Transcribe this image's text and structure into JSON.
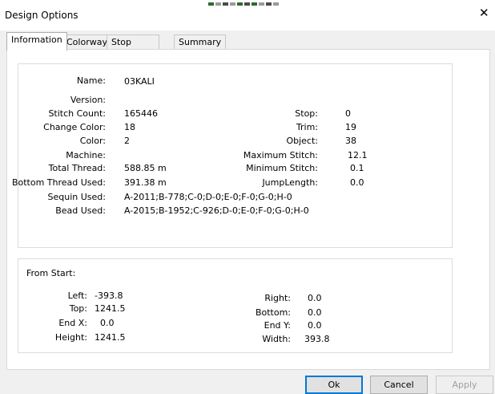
{
  "window": {
    "title": "Design Options",
    "close_glyph": "✕"
  },
  "tabs": [
    "Information",
    "Colorway",
    "Stop Sequence",
    "Summary"
  ],
  "info": {
    "name": {
      "label": "Name:",
      "value": "03KALI"
    },
    "version": {
      "label": "Version:",
      "value": ""
    },
    "stitch_count": {
      "label": "Stitch Count:",
      "value": "165446"
    },
    "change_color": {
      "label": "Change Color:",
      "value": "18"
    },
    "color": {
      "label": "Color:",
      "value": "2"
    },
    "machine": {
      "label": "Machine:",
      "value": ""
    },
    "total_thread": {
      "label": "Total Thread:",
      "value": "588.85 m"
    },
    "bottom_thread": {
      "label": "Bottom Thread Used:",
      "value": "391.38 m"
    },
    "sequin": {
      "label": "Sequin Used:",
      "value": "A-2011;B-778;C-0;D-0;E-0;F-0;G-0;H-0"
    },
    "bead": {
      "label": "Bead Used:",
      "value": "A-2015;B-1952;C-926;D-0;E-0;F-0;G-0;H-0"
    },
    "stop": {
      "label": "Stop:",
      "value": "0"
    },
    "trim": {
      "label": "Trim:",
      "value": "19"
    },
    "object": {
      "label": "Object:",
      "value": "38"
    },
    "max_stitch": {
      "label": "Maximum Stitch:",
      "value": "12.1"
    },
    "min_stitch": {
      "label": "Minimum Stitch:",
      "value": "0.1"
    },
    "jump_length": {
      "label": "JumpLength:",
      "value": "0.0"
    }
  },
  "from_start": {
    "heading": "From Start:",
    "left": {
      "label": "Left:",
      "value": "-393.8"
    },
    "top": {
      "label": "Top:",
      "value": "1241.5"
    },
    "end_x": {
      "label": "End X:",
      "value": "0.0"
    },
    "height": {
      "label": "Height:",
      "value": "1241.5"
    },
    "right": {
      "label": "Right:",
      "value": "0.0"
    },
    "bottom": {
      "label": "Bottom:",
      "value": "0.0"
    },
    "end_y": {
      "label": "End Y:",
      "value": "0.0"
    },
    "width": {
      "label": "Width:",
      "value": "393.8"
    }
  },
  "buttons": {
    "ok": "Ok",
    "cancel": "Cancel",
    "apply": "Apply"
  }
}
